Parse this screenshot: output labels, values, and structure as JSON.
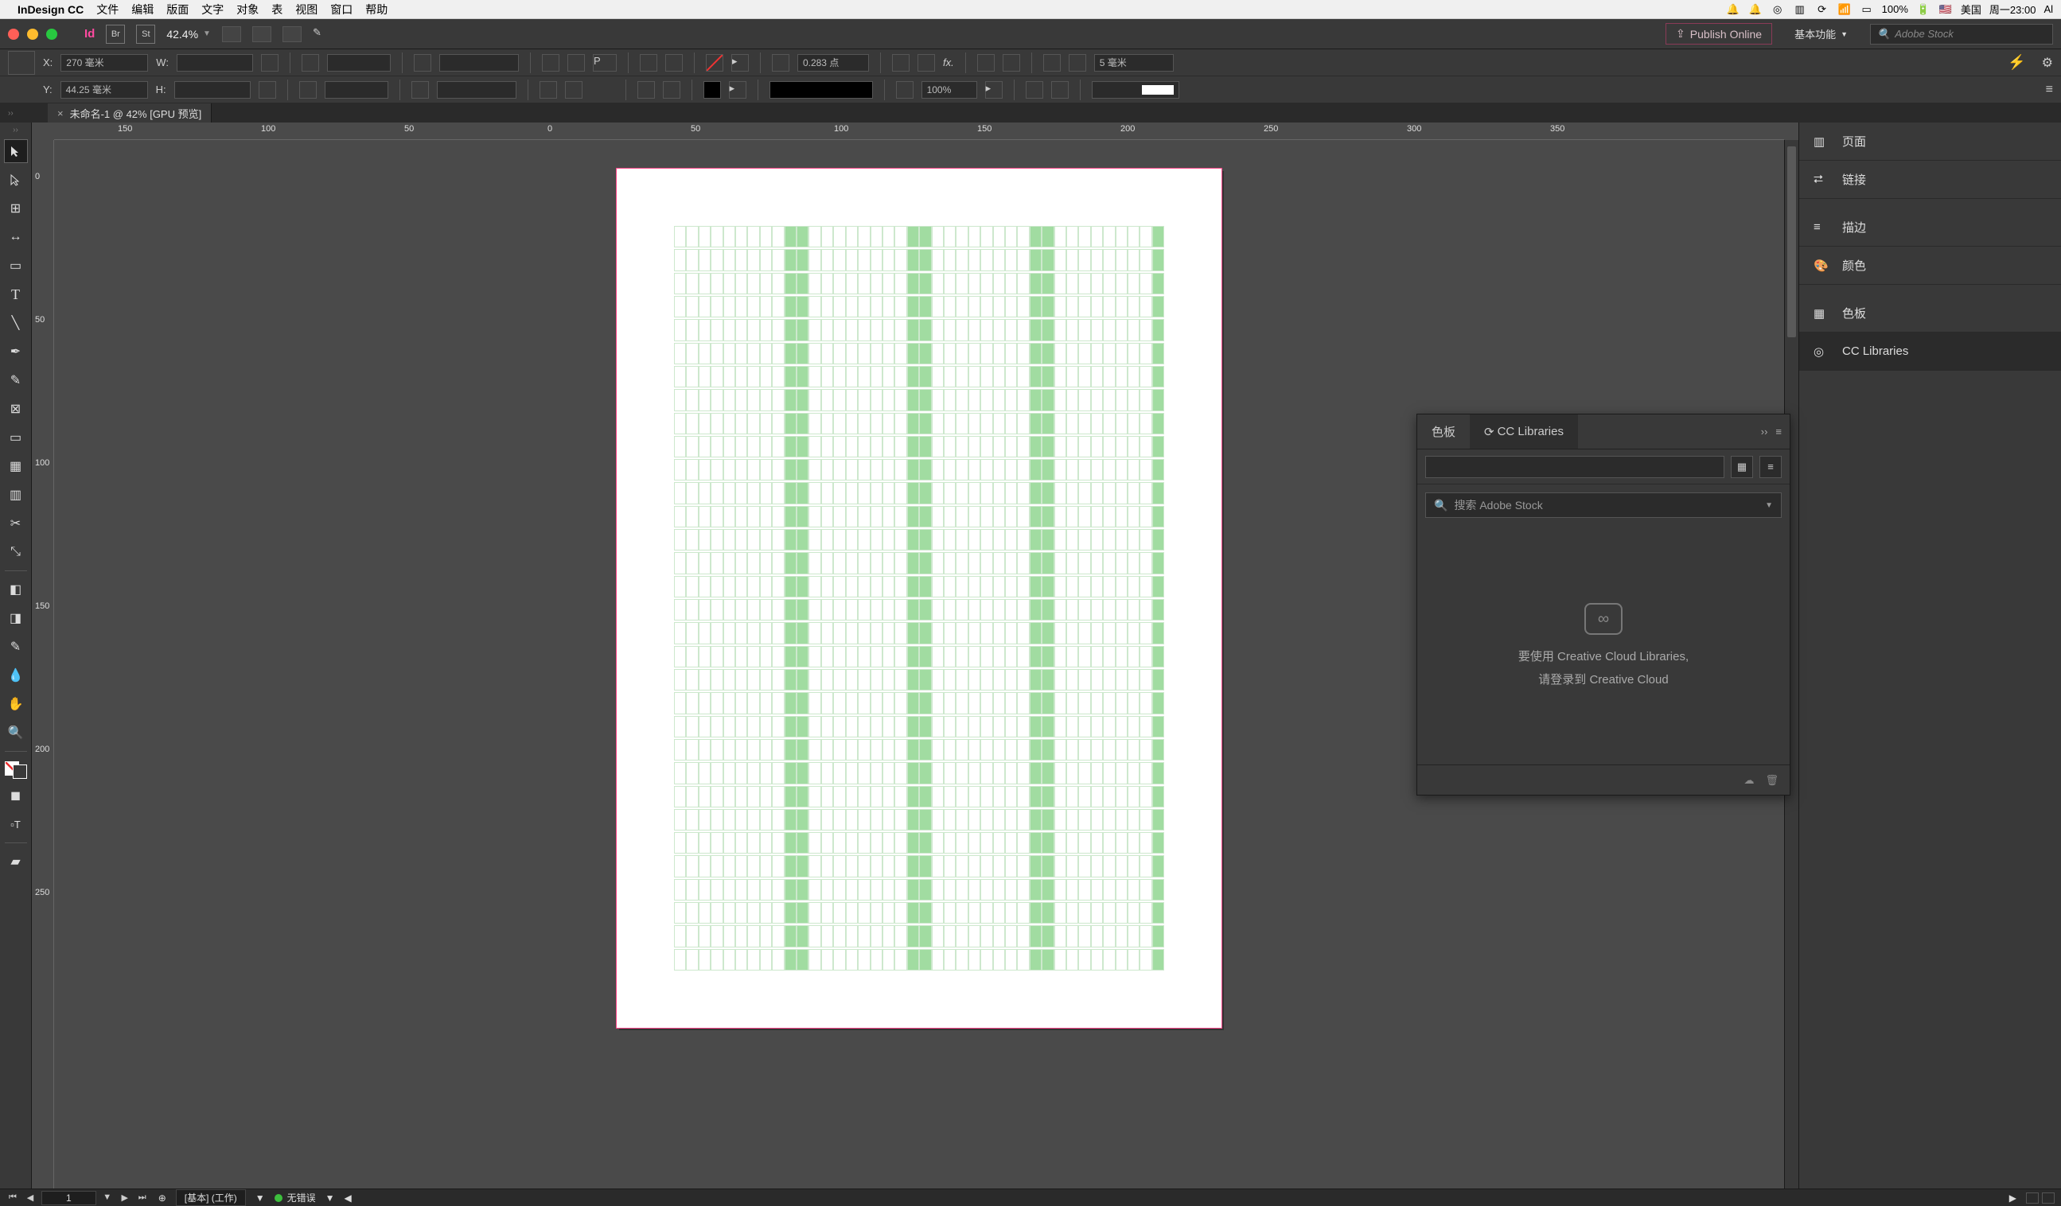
{
  "menubar": {
    "app": "InDesign CC",
    "items": [
      "文件",
      "编辑",
      "版面",
      "文字",
      "对象",
      "表",
      "视图",
      "窗口",
      "帮助"
    ],
    "battery": "100%",
    "locale": "美国",
    "clock": "周一23:00",
    "user": "Al"
  },
  "appbar": {
    "zoom": "42.4%",
    "publish": "Publish Online",
    "workspace": "基本功能",
    "stock_placeholder": "Adobe Stock"
  },
  "control": {
    "x_label": "X:",
    "x_val": "270 毫米",
    "y_label": "Y:",
    "y_val": "44.25 毫米",
    "w_label": "W:",
    "w_val": "",
    "h_label": "H:",
    "h_val": "",
    "stroke_val": "0.283 点",
    "opacity_val": "100%",
    "grid_spacing": "5 毫米"
  },
  "tab": {
    "title": "未命名-1 @ 42% [GPU 预览]"
  },
  "ruler": {
    "h": [
      "150",
      "100",
      "50",
      "0",
      "50",
      "100",
      "150",
      "200",
      "250",
      "300",
      "350"
    ],
    "v": [
      "0",
      "50",
      "100",
      "150",
      "200",
      "250"
    ]
  },
  "rightdock": {
    "items": [
      {
        "label": "页面",
        "icon": "pages"
      },
      {
        "label": "链接",
        "icon": "links"
      },
      {
        "label": "描边",
        "icon": "stroke"
      },
      {
        "label": "颜色",
        "icon": "color"
      },
      {
        "label": "色板",
        "icon": "swatches"
      },
      {
        "label": "CC Libraries",
        "icon": "cclib"
      }
    ]
  },
  "panel": {
    "tabs": [
      "色板",
      "CC Libraries"
    ],
    "active_tab": 1,
    "search_placeholder": "搜索 Adobe Stock",
    "msg1": "要使用 Creative Cloud Libraries,",
    "msg2": "请登录到 Creative Cloud"
  },
  "status": {
    "page": "1",
    "master": "[基本] (工作)",
    "errors": "无错误"
  }
}
